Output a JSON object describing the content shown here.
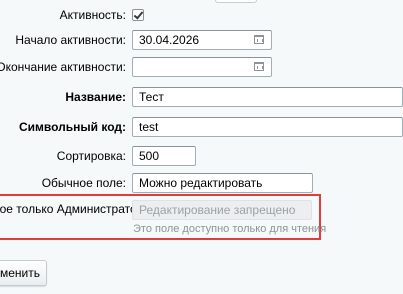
{
  "form": {
    "active_label": "Активность:",
    "active_checked": true,
    "start_label": "Начало активности:",
    "start_value": "30.04.2026",
    "end_label": "Окончание активности:",
    "end_value": "",
    "name_label": "Название:",
    "name_value": "Тест",
    "code_label": "Символьный код:",
    "code_value": "test",
    "sort_label": "Сортировка:",
    "sort_value": "500",
    "plain_label": "Обычное поле:",
    "plain_value": "Можно редактировать",
    "admin_label": "лное только Администратору:",
    "admin_placeholder": "Редактирование запрещено",
    "admin_hint": "Это поле доступно только для чтения"
  },
  "actions": {
    "cancel_label": "тменить"
  }
}
